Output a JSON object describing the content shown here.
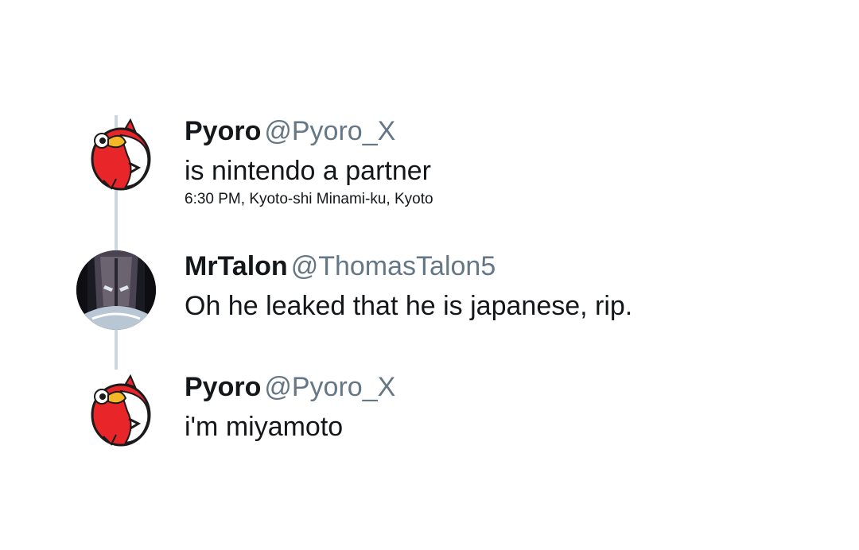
{
  "tweets": [
    {
      "name": "Pyoro",
      "handle": "@Pyoro_X",
      "text": "is nintendo a partner",
      "meta": "6:30 PM, Kyoto-shi Minami-ku, Kyoto",
      "avatar_icon": "pyoro-bird-icon"
    },
    {
      "name": "MrTalon",
      "handle": "@ThomasTalon5",
      "text": "Oh he leaked that he is japanese, rip.",
      "avatar_icon": "masked-figure-icon"
    },
    {
      "name": "Pyoro",
      "handle": "@Pyoro_X",
      "text": "i'm miyamoto",
      "avatar_icon": "pyoro-bird-icon"
    }
  ],
  "colors": {
    "name": "#14171a",
    "handle": "#657786",
    "thread_line": "#ccd6dd",
    "pyoro_red": "#e8262a",
    "pyoro_beak": "#f4b728"
  }
}
